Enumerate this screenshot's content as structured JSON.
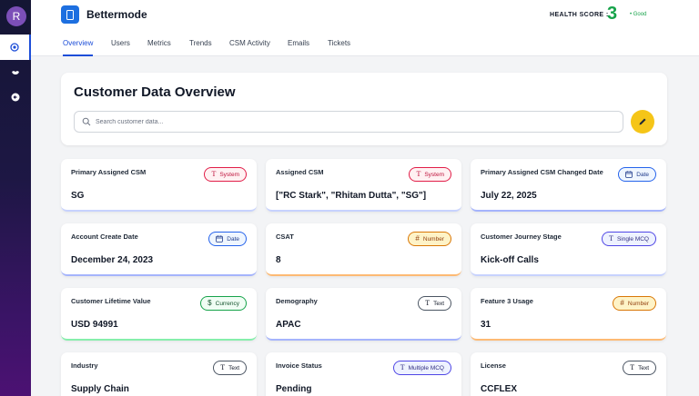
{
  "user": {
    "avatar_initial": "R"
  },
  "app": {
    "brand": "Bettermode"
  },
  "health": {
    "label": "HEALTH SCORE :",
    "value": "3",
    "status": "• Good"
  },
  "tabs": [
    {
      "label": "Overview",
      "active": true
    },
    {
      "label": "Users",
      "active": false
    },
    {
      "label": "Metrics",
      "active": false
    },
    {
      "label": "Trends",
      "active": false
    },
    {
      "label": "CSM Activity",
      "active": false
    },
    {
      "label": "Emails",
      "active": false
    },
    {
      "label": "Tickets",
      "active": false
    }
  ],
  "overview": {
    "title": "Customer Data Overview",
    "search_placeholder": "Search customer data..."
  },
  "fields": [
    {
      "label": "Primary Assigned CSM",
      "value": "SG",
      "type": "System",
      "icon": "text-icon"
    },
    {
      "label": "Assigned CSM",
      "value": "[\"RC Stark\", \"Rhitam Dutta\", \"SG\"]",
      "type": "System",
      "icon": "text-icon"
    },
    {
      "label": "Primary Assigned CSM Changed Date",
      "value": "July 22, 2025",
      "type": "Date",
      "icon": "calendar-icon"
    },
    {
      "label": "Account Create Date",
      "value": "December 24, 2023",
      "type": "Date",
      "icon": "calendar-icon"
    },
    {
      "label": "CSAT",
      "value": "8",
      "type": "Number",
      "icon": "hash-icon"
    },
    {
      "label": "Customer Journey Stage",
      "value": "Kick-off Calls",
      "type": "Single MCQ",
      "icon": "text-icon"
    },
    {
      "label": "Customer Lifetime Value",
      "value": "USD 94991",
      "type": "Currency",
      "icon": "dollar-icon"
    },
    {
      "label": "Demography",
      "value": "APAC",
      "type": "Text",
      "icon": "text-icon"
    },
    {
      "label": "Feature 3 Usage",
      "value": "31",
      "type": "Number",
      "icon": "hash-icon"
    },
    {
      "label": "Industry",
      "value": "Supply Chain",
      "type": "Text",
      "icon": "text-icon"
    },
    {
      "label": "Invoice Status",
      "value": "Pending",
      "type": "Multiple MCQ",
      "icon": "text-icon"
    },
    {
      "label": "License",
      "value": "CCFLEX",
      "type": "Text",
      "icon": "text-icon"
    }
  ],
  "badge_styles": {
    "System": {
      "border": "#e11d48",
      "text": "#be123c",
      "bg": "#fff1f2"
    },
    "Date": {
      "border": "#2563eb",
      "text": "#1e3a8a",
      "bg": "#eff6ff"
    },
    "Number": {
      "border": "#d97706",
      "text": "#92400e",
      "bg": "#fef3c7"
    },
    "Single MCQ": {
      "border": "#4f46e5",
      "text": "#312e81",
      "bg": "#eef2ff"
    },
    "Currency": {
      "border": "#16a34a",
      "text": "#14532d",
      "bg": "#f0fdf4"
    },
    "Text": {
      "border": "#4b5563",
      "text": "#111827",
      "bg": "#ffffff"
    },
    "Multiple MCQ": {
      "border": "#4f46e5",
      "text": "#312e81",
      "bg": "#eef2ff"
    }
  },
  "card_accents": {
    "System": "#c7d2fe",
    "Date": "#a5b4fc",
    "Number": "#fdba74",
    "Single MCQ": "#c7d2fe",
    "Currency": "#86efac",
    "Text": "#a5b4fc",
    "Multiple MCQ": "#c7d2fe"
  }
}
